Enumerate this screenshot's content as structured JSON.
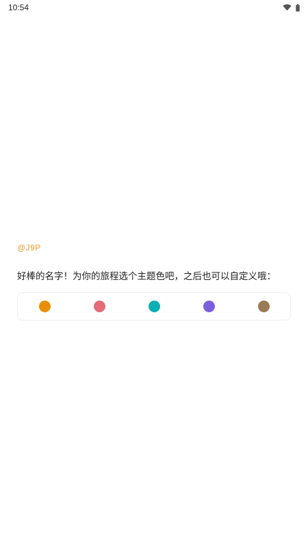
{
  "status_bar": {
    "time": "10:54",
    "icons": [
      "wifi-icon",
      "battery-icon"
    ]
  },
  "username": "@J9P",
  "prompt": "好棒的名字！为你的旅程选个主题色吧，之后也可以自定义哦：",
  "theme_colors": [
    {
      "name": "orange",
      "hex": "#E8900A"
    },
    {
      "name": "pink",
      "hex": "#E46B78"
    },
    {
      "name": "teal",
      "hex": "#0AAFB4"
    },
    {
      "name": "purple",
      "hex": "#7A5FDC"
    },
    {
      "name": "brown",
      "hex": "#9A7A54"
    }
  ]
}
